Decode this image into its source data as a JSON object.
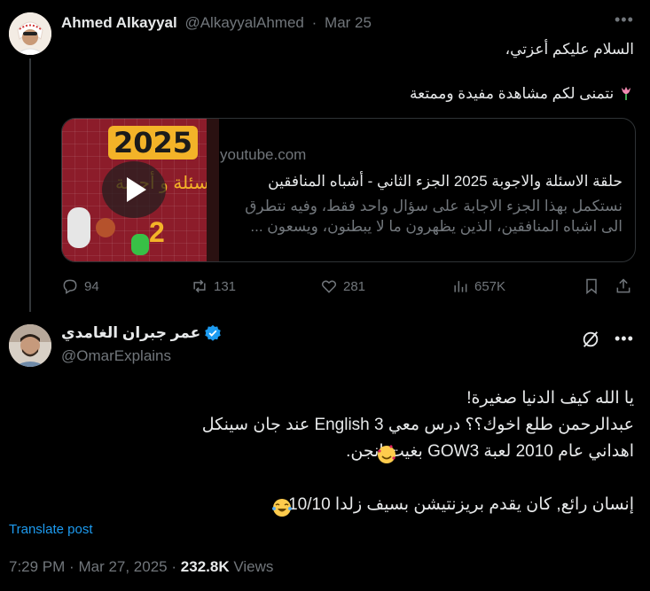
{
  "parent_tweet": {
    "author_name": "Ahmed Alkayyal",
    "handle": "@AlkayyalAhmed",
    "separator": "·",
    "date": "Mar 25",
    "line1": "السلام عليكم أعزتي،",
    "line2": "نتمنى لكم مشاهدة مفيدة وممتعة",
    "card": {
      "domain": "youtube.com",
      "title": "حلقة الاسئلة والاجوبة 2025 الجزء الثاني - أشباه المنافقين",
      "description": "نستكمل بهذا الجزء الاجابة على سؤال واحد فقط، وفيه نتطرق الى اشباه المنافقين، الذين يظهرون ما لا يبطنون، ويسعون ...",
      "thumb_year": "2025",
      "thumb_number": "2",
      "thumb_text": "أسئلة و أجوبة"
    },
    "stats": {
      "replies": "94",
      "reposts": "131",
      "likes": "281",
      "views": "657K"
    }
  },
  "main_tweet": {
    "author_name": "عمر جبران الغامدي",
    "handle": "@OmarExplains",
    "body": [
      "يا الله كيف الدنيا صغيرة!",
      "عبدالرحمن طلع اخوك؟؟ درس معي English 3 عند جان سينكل",
      "اهداني عام 2010 لعبة GOW3  بغيت انجن.",
      "إنسان رائع, كان يقدم بريزنتيشن بسيف زلدا 10/10"
    ],
    "translate_label": "Translate post",
    "time": "7:29 PM",
    "separator": "·",
    "date": "Mar 27, 2025",
    "views_count": "232.8K",
    "views_label": "Views"
  },
  "colors": {
    "background": "#000000",
    "text": "#e7e9ea",
    "muted": "#71767b",
    "accent": "#1d9bf0",
    "border": "#2f3336"
  }
}
